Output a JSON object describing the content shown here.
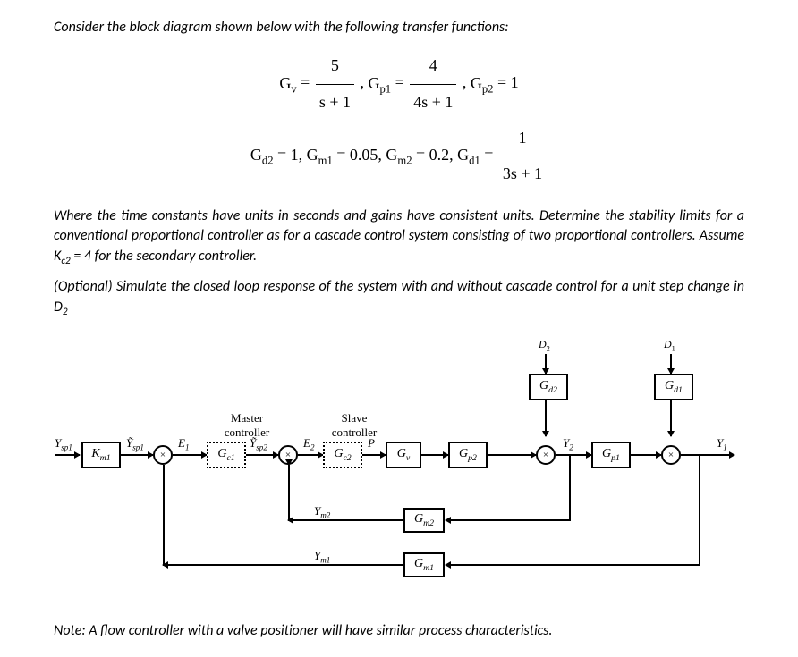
{
  "intro": "Consider the block diagram shown below with the following transfer functions:",
  "eq": {
    "gv_lhs": "G",
    "gv_sub": "v",
    "eq_sign": " = ",
    "gv_num": "5",
    "gv_den": "s + 1",
    "gp1_lhs": "G",
    "gp1_sub": "p1",
    "gp1_num": "4",
    "gp1_den": "4s + 1",
    "gp2_lhs": "G",
    "gp2_sub": "p2",
    "gp2_rhs": " = 1",
    "gd2_lhs": "G",
    "gd2_sub": "d2",
    "gd2_rhs": " = 1, ",
    "gm1_lhs": "G",
    "gm1_sub": "m1",
    "gm1_rhs": " = 0.05, ",
    "gm2_lhs": "G",
    "gm2_sub": "m2",
    "gm2_rhs": " = 0.2, ",
    "gd1_lhs": "G",
    "gd1_sub": "d1",
    "gd1_eq": " = ",
    "gd1_num": "1",
    "gd1_den": "3s + 1",
    "comma": ", "
  },
  "para1": "Where the time constants have units in seconds and gains have consistent units. Determine the stability limits for a conventional proportional controller as for a cascade control system consisting of two proportional controllers. Assume K",
  "para1_sub": "c2",
  "para1_tail": " = 4 for the secondary controller.",
  "para2": "(Optional) Simulate the closed loop response of the system with and without cascade control for a unit step change in D",
  "para2_sub": "2",
  "diagram": {
    "D2": "D",
    "D2s": "2",
    "D1": "D",
    "D1s": "1",
    "Gd2": "G",
    "Gd2s": "d2",
    "Gd1": "G",
    "Gd1s": "d1",
    "master1": "Master",
    "master2": "controller",
    "slave1": "Slave",
    "slave2": "controller",
    "Ysp1": "Y",
    "Ysp1s": "sp1",
    "Ytil_sp1": "Ỹ",
    "Ytil_sp1s": "sp1",
    "Km1": "K",
    "Km1s": "m1",
    "E1": "E",
    "E1s": "1",
    "Gc1": "G",
    "Gc1s": "c1",
    "Ytil_sp2": "Ỹ",
    "Ytil_sp2s": "sp2",
    "E2": "E",
    "E2s": "2",
    "Gc2": "G",
    "Gc2s": "c2",
    "P": "P",
    "Gv": "G",
    "Gvs": "v",
    "Gp2": "G",
    "Gp2s": "p2",
    "Y2": "Y",
    "Y2s": "2",
    "Gp1": "G",
    "Gp1s": "p1",
    "Y1": "Y",
    "Y1s": "1",
    "Ym2": "Y",
    "Ym2s": "m2",
    "Gm2": "G",
    "Gm2s": "m2",
    "Ym1": "Y",
    "Ym1s": "m1",
    "Gm1": "G",
    "Gm1s": "m1"
  },
  "note": "Note: A flow controller with a valve positioner will have similar process characteristics."
}
